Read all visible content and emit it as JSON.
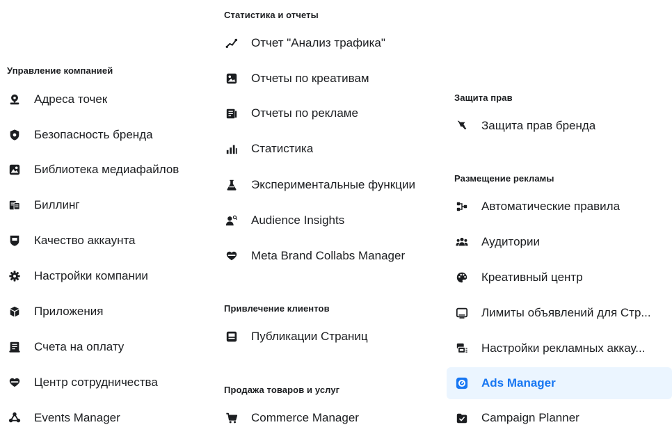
{
  "colors": {
    "text": "#1c1e21",
    "accent": "#1877f2",
    "active_bg": "#ebf5ff",
    "icon": "#1c1e21"
  },
  "col1": {
    "title": "Управление компанией",
    "items": [
      {
        "label": "Адреса точек",
        "icon": "location-pin-icon"
      },
      {
        "label": "Безопасность бренда",
        "icon": "shield-icon"
      },
      {
        "label": "Библиотека медиафайлов",
        "icon": "media-library-icon"
      },
      {
        "label": "Биллинг",
        "icon": "billing-icon"
      },
      {
        "label": "Качество аккаунта",
        "icon": "account-quality-icon"
      },
      {
        "label": "Настройки компании",
        "icon": "gear-icon"
      },
      {
        "label": "Приложения",
        "icon": "cube-icon"
      },
      {
        "label": "Счета на оплату",
        "icon": "invoice-icon"
      },
      {
        "label": "Центр сотрудничества",
        "icon": "collab-icon"
      },
      {
        "label": "Events Manager",
        "icon": "events-manager-icon"
      }
    ]
  },
  "col2": {
    "sections": [
      {
        "title": "Статистика и отчеты",
        "items": [
          {
            "label": "Отчет \"Анализ трафика\"",
            "icon": "traffic-analysis-icon"
          },
          {
            "label": "Отчеты по креативам",
            "icon": "creative-report-icon"
          },
          {
            "label": "Отчеты по рекламе",
            "icon": "ads-report-icon"
          },
          {
            "label": "Статистика",
            "icon": "bar-chart-icon"
          },
          {
            "label": "Экспериментальные функции",
            "icon": "flask-icon"
          },
          {
            "label": "Audience Insights",
            "icon": "audience-insights-icon"
          },
          {
            "label": "Meta Brand Collabs Manager",
            "icon": "handshake-icon"
          }
        ]
      },
      {
        "title": "Привлечение клиентов",
        "items": [
          {
            "label": "Публикации Страниц",
            "icon": "page-posts-icon"
          }
        ]
      },
      {
        "title": "Продажа товаров и услуг",
        "items": [
          {
            "label": "Commerce Manager",
            "icon": "cart-icon"
          }
        ]
      }
    ]
  },
  "col3": {
    "sections": [
      {
        "title": "Защита прав",
        "items": [
          {
            "label": "Защита прав бренда",
            "icon": "brand-flag-icon"
          }
        ]
      },
      {
        "title": "Размещение рекламы",
        "items": [
          {
            "label": "Автоматические правила",
            "icon": "automation-icon"
          },
          {
            "label": "Аудитории",
            "icon": "people-icon"
          },
          {
            "label": "Креативный центр",
            "icon": "palette-icon"
          },
          {
            "label": "Лимиты объявлений для Стр...",
            "icon": "ad-limits-icon"
          },
          {
            "label": "Настройки рекламных аккау...",
            "icon": "ad-account-settings-icon"
          },
          {
            "label": "Ads Manager",
            "icon": "ads-manager-icon",
            "active": true
          },
          {
            "label": "Campaign Planner",
            "icon": "campaign-planner-icon"
          }
        ]
      }
    ]
  }
}
